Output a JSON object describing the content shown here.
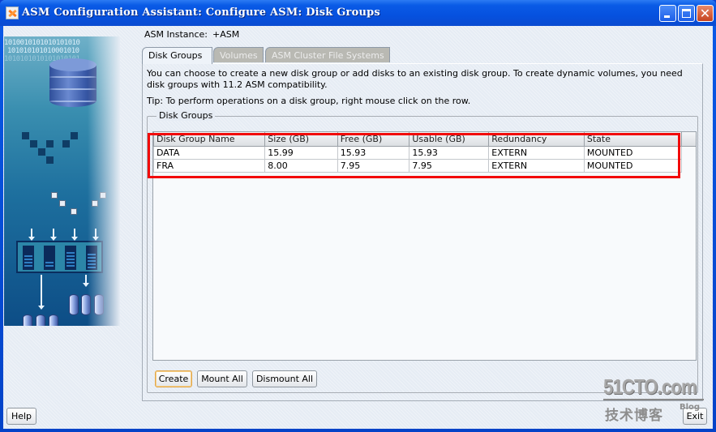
{
  "window": {
    "title": "ASM Configuration Assistant: Configure ASM: Disk Groups",
    "controls": [
      "minimize",
      "maximize",
      "close"
    ],
    "close_glyph": "✕"
  },
  "instance": {
    "label": "ASM Instance:",
    "value": "+ASM"
  },
  "tabs": [
    {
      "label": "Disk Groups",
      "state": "active"
    },
    {
      "label": "Volumes",
      "state": "disabled"
    },
    {
      "label": "ASM Cluster File Systems",
      "state": "disabled"
    }
  ],
  "content": {
    "intro": "You can choose to create a new disk group or add disks to an existing disk group. To create dynamic volumes, you need disk groups with 11.2 ASM compatibility.",
    "tip": "Tip: To perform operations on a disk group, right mouse click on the row.",
    "group_title": "Disk Groups"
  },
  "table": {
    "columns": [
      "Disk Group Name",
      "Size (GB)",
      "Free (GB)",
      "Usable (GB)",
      "Redundancy",
      "State"
    ],
    "rows": [
      [
        "DATA",
        "15.99",
        "15.93",
        "15.93",
        "EXTERN",
        "MOUNTED"
      ],
      [
        "FRA",
        "8.00",
        "7.95",
        "7.95",
        "EXTERN",
        "MOUNTED"
      ]
    ]
  },
  "buttons": {
    "create": "Create",
    "mount_all": "Mount All",
    "dismount_all": "Dismount All",
    "help": "Help",
    "exit": "Exit"
  },
  "banner": {
    "binary_line_1": "1010010101010101010",
    "binary_line_2": "101010101010001010",
    "binary_line_3": "1010101010101010101"
  },
  "watermark": {
    "main": "51CTO.com",
    "sub": "技术博客",
    "tag": "Blog"
  },
  "colors": {
    "highlight": "#f20a0a",
    "titlebar": "#0651df",
    "default_button_border": "#e0a54a"
  }
}
